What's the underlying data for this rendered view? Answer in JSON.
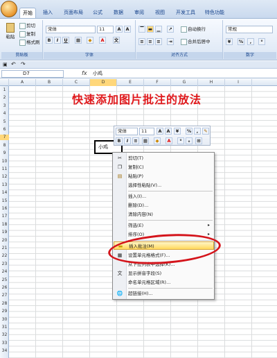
{
  "tabs": [
    "开始",
    "插入",
    "页面布局",
    "公式",
    "数据",
    "审阅",
    "视图",
    "开发工具",
    "特色功能"
  ],
  "clipboard": {
    "paste": "粘贴",
    "cut": "剪切",
    "copy": "复制",
    "format_painter": "格式刷",
    "label": "剪贴板"
  },
  "font": {
    "name": "宋体",
    "size": "11",
    "bold": "B",
    "italic": "I",
    "underline": "U",
    "label": "字体"
  },
  "alignment": {
    "wrap": "自动换行",
    "merge": "合并后居中",
    "label": "对齐方式"
  },
  "number": {
    "format": "常规",
    "percent": "%",
    "comma": ",",
    "label": "数字"
  },
  "formula_bar": {
    "name_box": "D7",
    "fx": "fx",
    "value": "小鸡"
  },
  "columns": [
    "A",
    "B",
    "C",
    "D",
    "E",
    "F",
    "G",
    "H",
    "I"
  ],
  "rows": [
    "1",
    "2",
    "3",
    "4",
    "5",
    "6",
    "7",
    "8",
    "9",
    "10",
    "11",
    "12",
    "13",
    "14",
    "15",
    "16",
    "17",
    "18",
    "19",
    "20",
    "21",
    "22",
    "23",
    "24",
    "25",
    "26",
    "27",
    "28",
    "29",
    "30",
    "31",
    "32",
    "33",
    "34"
  ],
  "title": "快速添加图片批注的放法",
  "cell_value": "小鸡",
  "mini_toolbar": {
    "font": "宋体",
    "size": "11",
    "bold": "B",
    "italic": "I",
    "align": "≡",
    "percent": "%",
    "comma": ","
  },
  "context_menu": [
    "剪切(T)",
    "复制(C)",
    "粘贴(P)",
    "选择性粘贴(V)...",
    "插入(I)...",
    "删除(D)...",
    "清除内容(N)",
    "筛选(E)",
    "排序(O)",
    "插入批注(M)",
    "设置单元格格式(F)...",
    "从下拉列表中选择(K)...",
    "显示拼音字段(S)",
    "命名单元格区域(R)...",
    "超链接(H)..."
  ]
}
